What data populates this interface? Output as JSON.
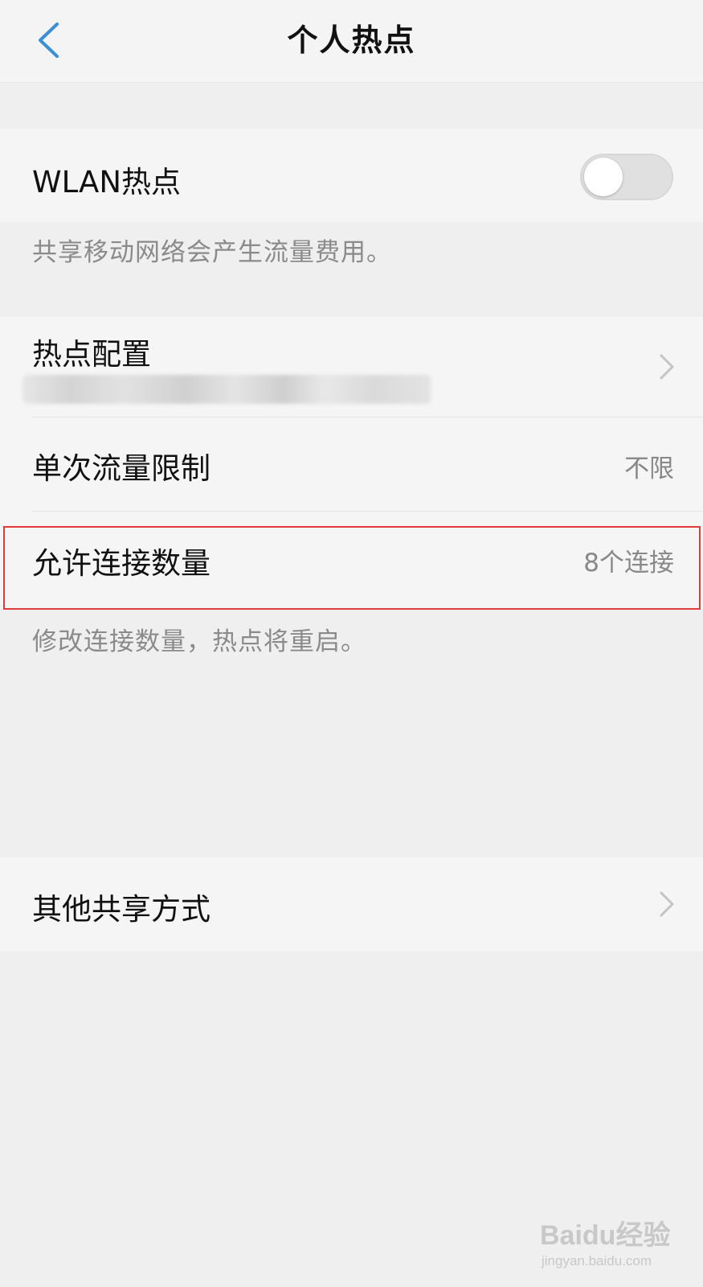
{
  "header": {
    "title": "个人热点"
  },
  "wlan": {
    "label": "WLAN热点",
    "enabled": false,
    "note": "共享移动网络会产生流量费用。"
  },
  "settings": {
    "hotspot_config": {
      "label": "热点配置"
    },
    "data_limit": {
      "label": "单次流量限制",
      "value": "不限"
    },
    "max_connections": {
      "label": "允许连接数量",
      "value": "8个连接",
      "note": "修改连接数量，热点将重启。"
    }
  },
  "other": {
    "label": "其他共享方式"
  },
  "watermark": {
    "brand": "Baidu经验",
    "url": "jingyan.baidu.com"
  },
  "colors": {
    "accent": "#3b8fd9",
    "highlight": "#e23b3b"
  }
}
